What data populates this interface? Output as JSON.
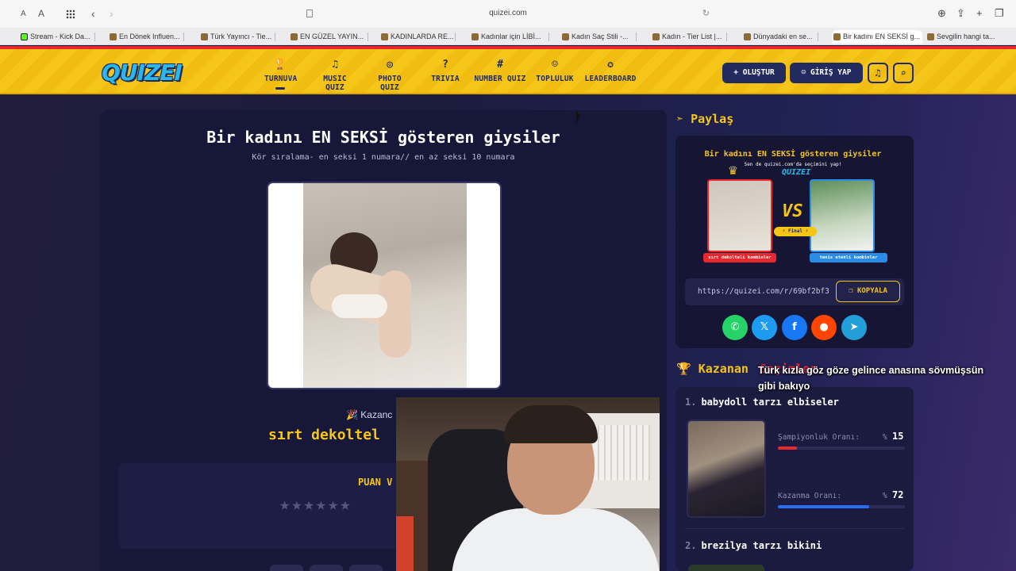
{
  "browser": {
    "url": "quizei.com",
    "text_small": "A",
    "text_large": "A",
    "tabs": [
      "Stream - Kick Da...",
      "En Dönek Influen...",
      "Türk Yayıncı - Tie...",
      "EN GÜZEL YAYIN...",
      "KADINLARDA RE...",
      "Kadınlar için LİBİ...",
      "Kadın Saç Stili -...",
      "Kadın - Tier List |...",
      "Dünyadaki en se...",
      "Bir kadını EN SEKSİ g...",
      "Sevgilin hangi ta..."
    ]
  },
  "site": {
    "logo": "QUIZEI",
    "nav": [
      {
        "label": "TURNUVA",
        "icon": "trophy-icon",
        "glyph": "🏆"
      },
      {
        "label": "MUSIC QUIZ",
        "icon": "music-icon",
        "glyph": "♫"
      },
      {
        "label": "PHOTO QUIZ",
        "icon": "camera-icon",
        "glyph": "◎"
      },
      {
        "label": "TRIVIA",
        "icon": "question-icon",
        "glyph": "?"
      },
      {
        "label": "NUMBER QUIZ",
        "icon": "hash-icon",
        "glyph": "#"
      },
      {
        "label": "TOPLULUK",
        "icon": "users-icon",
        "glyph": "☺"
      },
      {
        "label": "LEADERBOARD",
        "icon": "award-icon",
        "glyph": "✪"
      }
    ],
    "create_label": "+ OLUŞTUR",
    "login_label": "GİRİŞ YAP"
  },
  "quiz": {
    "title": "Bir kadını EN SEKSİ gösteren giysiler",
    "subtitle": "Kör sıralama- en seksi 1 numara// en az seksi 10 numara",
    "winner_label": "🎉 Kazanc",
    "winner_name": "sırt dekoltel",
    "rate_label": "PUAN V",
    "stars": "★★★★★★"
  },
  "share": {
    "title": "Paylaş",
    "preview_title": "Bir kadını EN SEKSİ gösteren giysiler",
    "preview_sub": "Sen de quizei.com'da seçimini yap!",
    "mini_logo": "QUIZEI",
    "vs": "VS",
    "final": "⚡ Final ⚡",
    "left_tag": "sırt dekolteli kombinler",
    "right_tag": "tenis etekli kombinler",
    "link": "https://quizei.com/r/69bf2bf3",
    "copy_label": "KOPYALA",
    "socials": [
      {
        "name": "whatsapp",
        "glyph": "✆",
        "color": "#25d366"
      },
      {
        "name": "x",
        "glyph": "𝕏",
        "color": "#1d9bf0"
      },
      {
        "name": "facebook",
        "glyph": "f",
        "color": "#1877f2"
      },
      {
        "name": "reddit",
        "glyph": "●",
        "color": "#ff4500"
      },
      {
        "name": "telegram",
        "glyph": "➤",
        "color": "#229ed9"
      }
    ]
  },
  "winners": {
    "title": "Kazanan",
    "title_red": "Seçimler",
    "overlay_subtitle": "Türk kızla göz göze gelince anasına sövmüşsün gibi bakıyo",
    "items": [
      {
        "rank": "1.",
        "name": "babydoll tarzı elbiseler",
        "champ_label": "Şampiyonluk Oranı:",
        "champ_pct": "%",
        "champ_value": "15",
        "champ_fraction": 0.15,
        "win_label": "Kazanma Oranı:",
        "win_pct": "%",
        "win_value": "72",
        "win_fraction": 0.72
      },
      {
        "rank": "2.",
        "name": "brezilya tarzı bikini"
      }
    ]
  },
  "colors": {
    "accent": "#f5c518",
    "danger": "#e8272e",
    "navy": "#232a5e",
    "blue": "#2b6cf0"
  }
}
